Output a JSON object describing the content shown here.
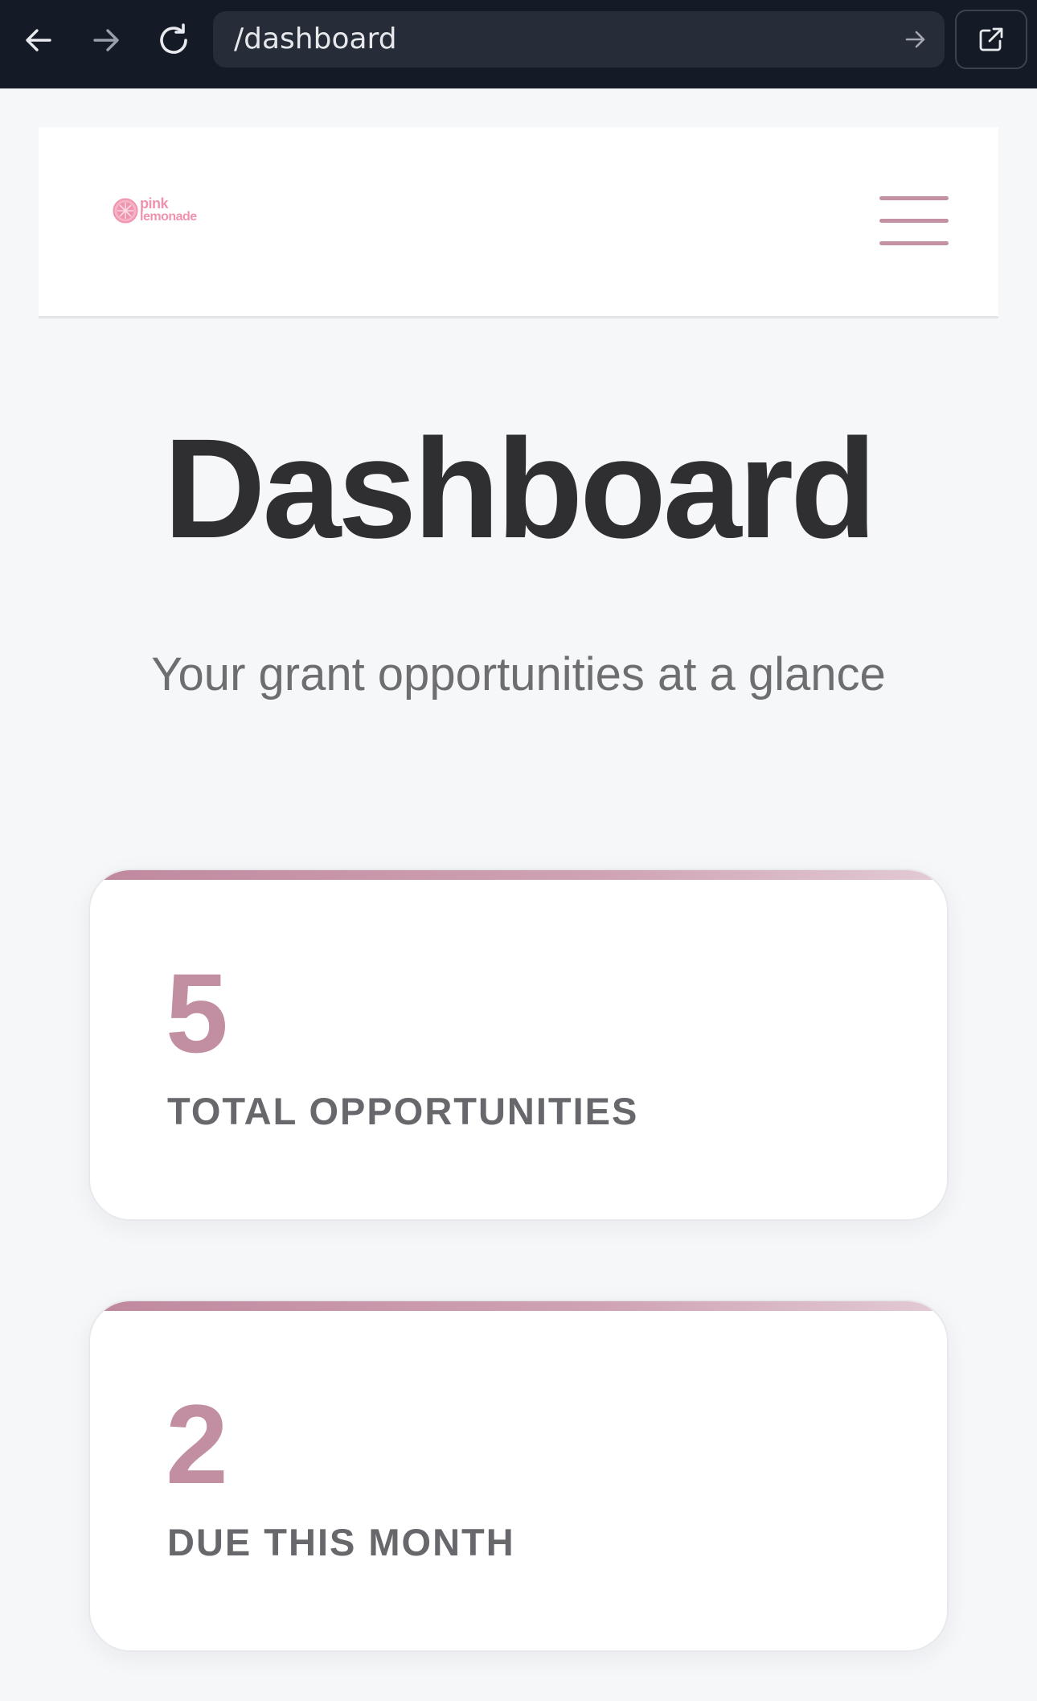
{
  "browser": {
    "url": "/dashboard",
    "icons": [
      "back-arrow-icon",
      "forward-arrow-icon",
      "reload-icon",
      "go-arrow-icon",
      "open-external-icon"
    ]
  },
  "header": {
    "logo": {
      "word_1": "pink",
      "word_2": "lemonade",
      "color": "#ef93ae"
    },
    "menu_icon": "hamburger-menu-icon",
    "menu_color": "#c391a3"
  },
  "main": {
    "title": "Dashboard",
    "subtitle": "Your grant opportunities at a glance"
  },
  "stats": [
    {
      "value": "5",
      "label": "TOTAL OPPORTUNITIES"
    },
    {
      "value": "2",
      "label": "DUE THIS MONTH"
    }
  ],
  "colors": {
    "accent": "#c28ea1",
    "title": "#2f2f31",
    "muted_text": "#68686c",
    "browser_chrome": "#141a26"
  }
}
